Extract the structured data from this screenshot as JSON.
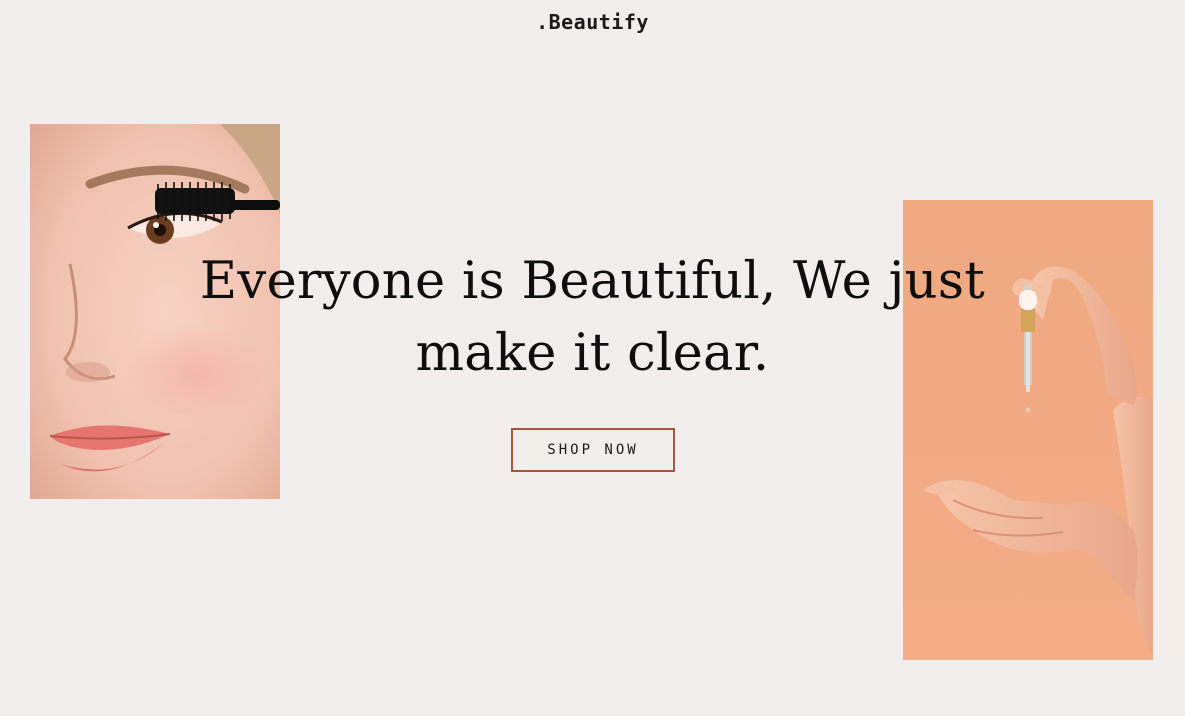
{
  "header": {
    "brand": ".Beautify"
  },
  "hero": {
    "headline": "Everyone is Beautiful, We just make it clear.",
    "cta_label": "SHOP NOW"
  },
  "colors": {
    "background": "#f2eeee",
    "accent_border": "#a0573b",
    "peach_backdrop": "#f0a981"
  }
}
